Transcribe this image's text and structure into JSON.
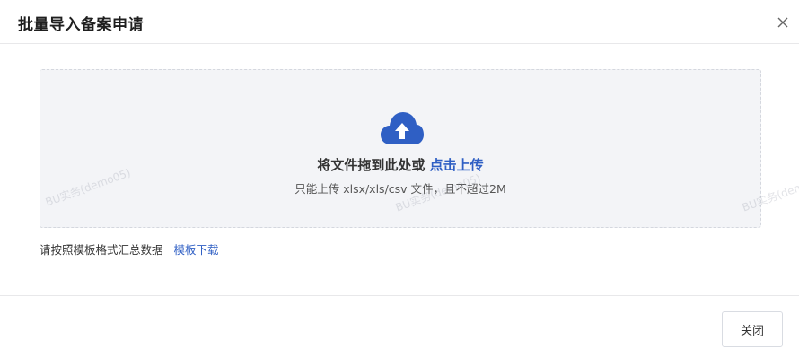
{
  "dialog": {
    "title": "批量导入备案申请",
    "close_icon": "close-icon"
  },
  "upload": {
    "icon": "cloud-upload-icon",
    "main_text": "将文件拖到此处或",
    "link_text": "点击上传",
    "hint": "只能上传 xlsx/xls/csv 文件，且不超过2M"
  },
  "watermark": {
    "text": "BU实务(demo05)"
  },
  "template": {
    "prefix": "请按照模板格式汇总数据",
    "link": "模板下载"
  },
  "footer": {
    "close_label": "关闭"
  },
  "colors": {
    "accent": "#2f5fc4",
    "dropzone_bg": "#f3f4f7"
  }
}
